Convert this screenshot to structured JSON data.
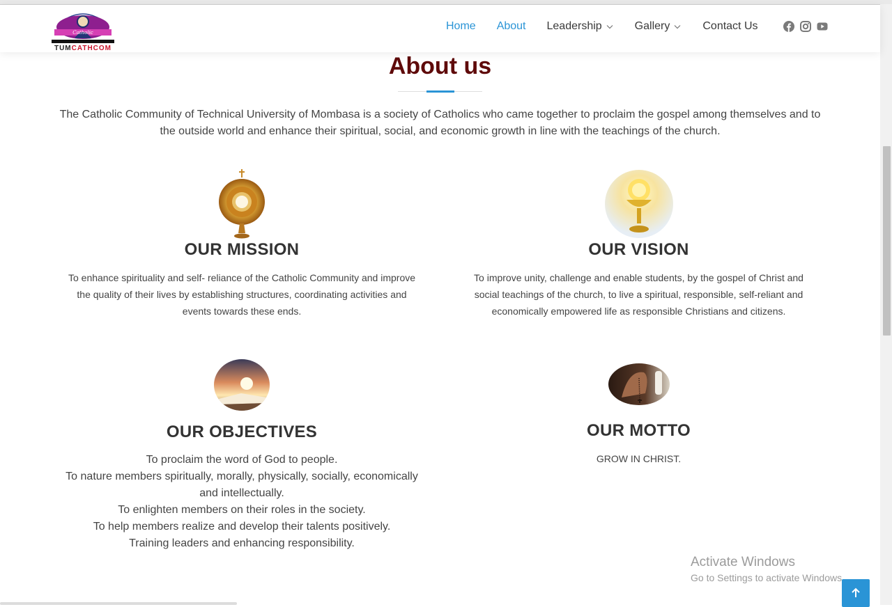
{
  "brand": {
    "logo_text_dark": "TUM",
    "logo_text_red": "CATHCOM",
    "banner": "Catholic"
  },
  "nav": {
    "items": [
      {
        "label": "Home"
      },
      {
        "label": "About"
      },
      {
        "label": "Leadership"
      },
      {
        "label": "Gallery"
      },
      {
        "label": "Contact Us"
      }
    ]
  },
  "socials": [
    "facebook-icon",
    "instagram-icon",
    "youtube-icon"
  ],
  "page": {
    "title": "About us",
    "intro": "The Catholic Community of Technical University of Mombasa is a society of Catholics who came together to proclaim the gospel among themselves and to the outside world and enhance their spiritual, social, and economic growth in line with the teachings of the church."
  },
  "mission": {
    "heading": "OUR MISSION",
    "text": "To enhance spirituality and self- reliance of the Catholic Community and improve the quality of their lives by establishing structures, coordinating activities and events towards these ends."
  },
  "vision": {
    "heading": "OUR VISION",
    "text": "To improve unity, challenge and enable students, by the gospel of Christ and social teachings of the church, to live a spiritual, responsible, self-reliant and economically empowered life as responsible Christians and citizens."
  },
  "objectives": {
    "heading": "OUR OBJECTIVES",
    "items": [
      "To proclaim the word of God to people.",
      "To nature members spiritually, morally, physically, socially, economically and intellectually.",
      "To enlighten members on their roles in the society.",
      "To help members realize and develop their talents positively.",
      "Training leaders and enhancing responsibility."
    ]
  },
  "motto": {
    "heading": "OUR MOTTO",
    "text": "GROW IN CHRIST."
  },
  "watermark": {
    "line1": "Activate Windows",
    "line2": "Go to Settings to activate Windows."
  },
  "colors": {
    "accent": "#2a94d6",
    "title": "#5f0a0a",
    "logo_red": "#c9142b"
  }
}
